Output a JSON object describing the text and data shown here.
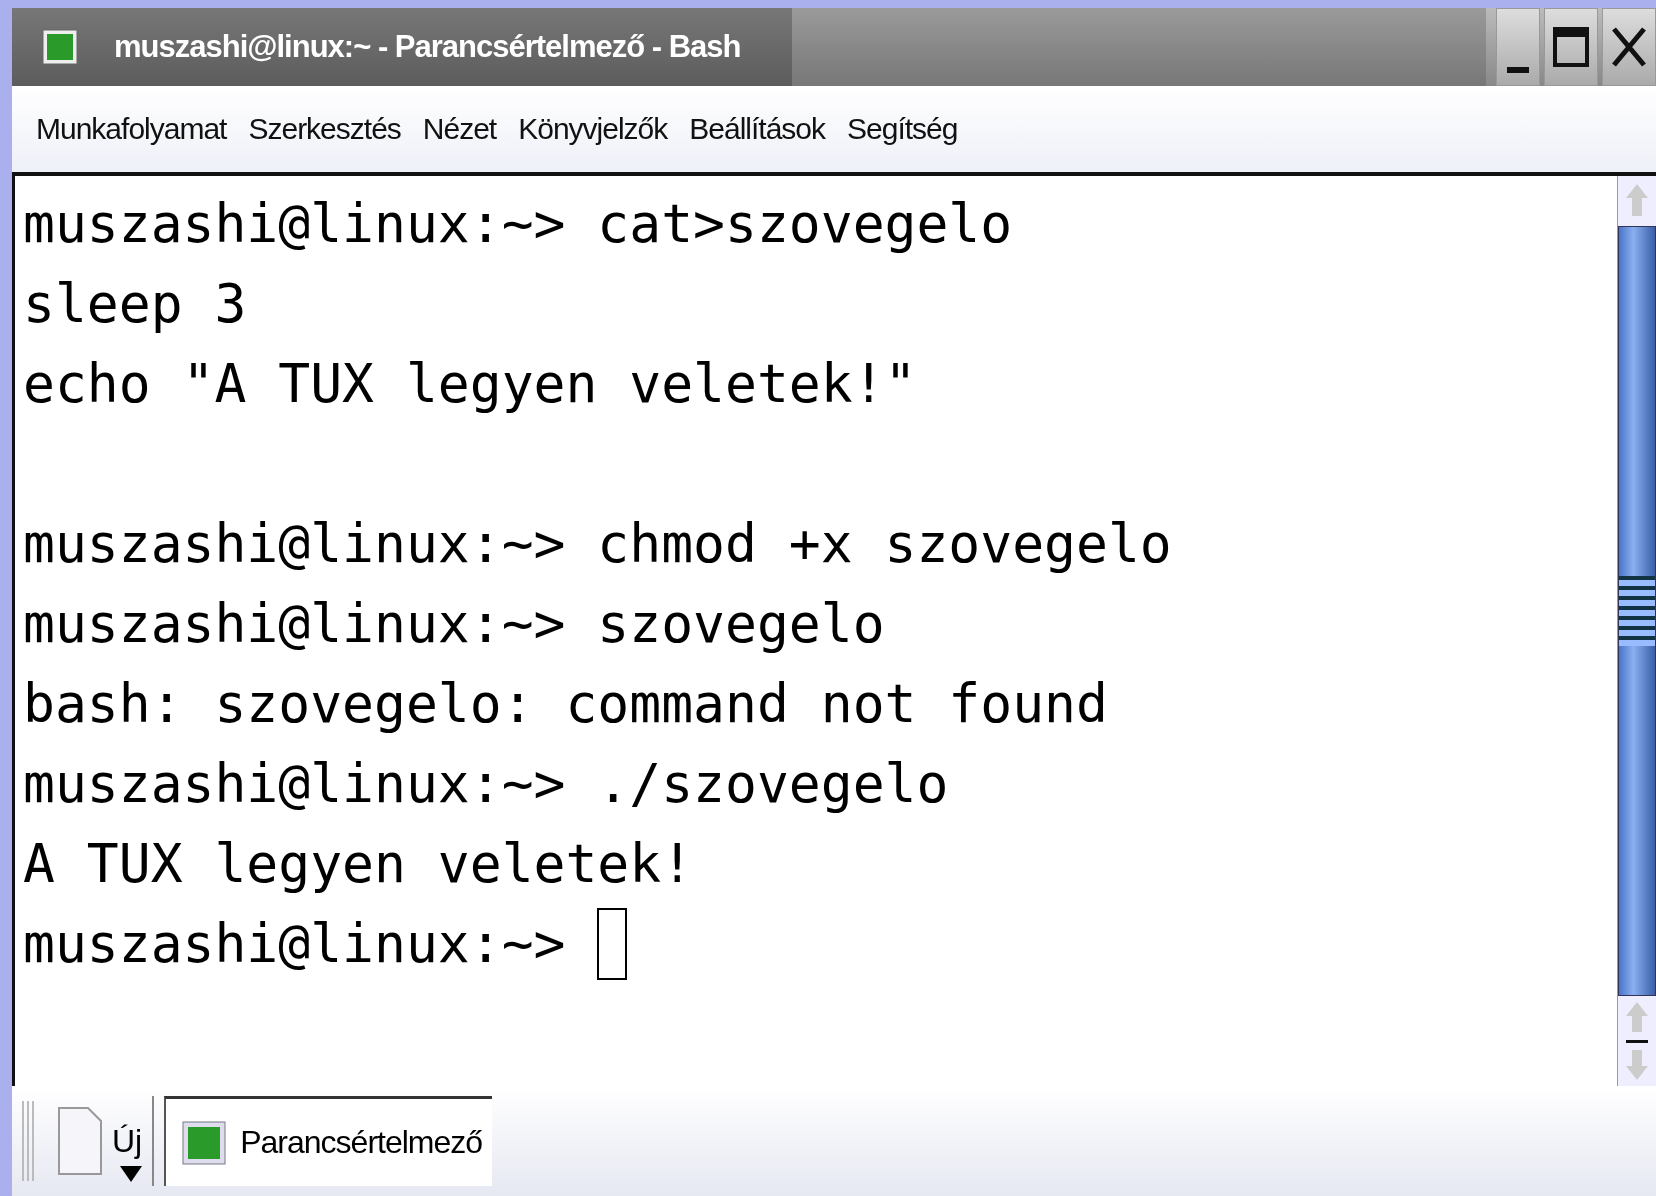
{
  "window": {
    "title": "muszashi@linux:~ - Parancsértelmező - Bash"
  },
  "menu": [
    "Munkafolyamat",
    "Szerkesztés",
    "Nézet",
    "Könyvjelzők",
    "Beállítások",
    "Segítség"
  ],
  "terminal": {
    "blocks": [
      [
        "muszashi@linux:~> cat>szovegelo",
        "sleep 3",
        "echo \"A TUX legyen veletek!\""
      ],
      [
        "muszashi@linux:~> chmod +x szovegelo",
        "muszashi@linux:~> szovegelo",
        "bash: szovegelo: command not found",
        "muszashi@linux:~> ./szovegelo",
        "A TUX legyen veletek!"
      ]
    ],
    "prompt": "muszashi@linux:~> ",
    "cursor": true
  },
  "tabbar": {
    "new_button": "Új",
    "tabs": [
      {
        "label": "Parancsértelmező",
        "selected": true
      }
    ]
  }
}
